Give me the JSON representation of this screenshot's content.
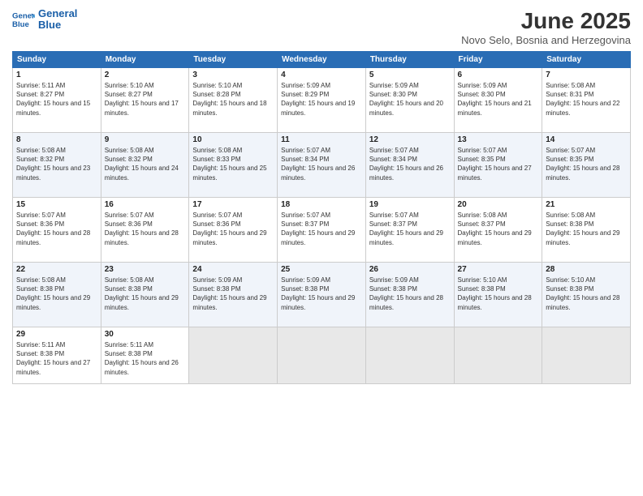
{
  "header": {
    "logo_line1": "General",
    "logo_line2": "Blue",
    "month": "June 2025",
    "location": "Novo Selo, Bosnia and Herzegovina"
  },
  "weekdays": [
    "Sunday",
    "Monday",
    "Tuesday",
    "Wednesday",
    "Thursday",
    "Friday",
    "Saturday"
  ],
  "weeks": [
    [
      {
        "day": "1",
        "sunrise": "Sunrise: 5:11 AM",
        "sunset": "Sunset: 8:27 PM",
        "daylight": "Daylight: 15 hours and 15 minutes."
      },
      {
        "day": "2",
        "sunrise": "Sunrise: 5:10 AM",
        "sunset": "Sunset: 8:27 PM",
        "daylight": "Daylight: 15 hours and 17 minutes."
      },
      {
        "day": "3",
        "sunrise": "Sunrise: 5:10 AM",
        "sunset": "Sunset: 8:28 PM",
        "daylight": "Daylight: 15 hours and 18 minutes."
      },
      {
        "day": "4",
        "sunrise": "Sunrise: 5:09 AM",
        "sunset": "Sunset: 8:29 PM",
        "daylight": "Daylight: 15 hours and 19 minutes."
      },
      {
        "day": "5",
        "sunrise": "Sunrise: 5:09 AM",
        "sunset": "Sunset: 8:30 PM",
        "daylight": "Daylight: 15 hours and 20 minutes."
      },
      {
        "day": "6",
        "sunrise": "Sunrise: 5:09 AM",
        "sunset": "Sunset: 8:30 PM",
        "daylight": "Daylight: 15 hours and 21 minutes."
      },
      {
        "day": "7",
        "sunrise": "Sunrise: 5:08 AM",
        "sunset": "Sunset: 8:31 PM",
        "daylight": "Daylight: 15 hours and 22 minutes."
      }
    ],
    [
      {
        "day": "8",
        "sunrise": "Sunrise: 5:08 AM",
        "sunset": "Sunset: 8:32 PM",
        "daylight": "Daylight: 15 hours and 23 minutes."
      },
      {
        "day": "9",
        "sunrise": "Sunrise: 5:08 AM",
        "sunset": "Sunset: 8:32 PM",
        "daylight": "Daylight: 15 hours and 24 minutes."
      },
      {
        "day": "10",
        "sunrise": "Sunrise: 5:08 AM",
        "sunset": "Sunset: 8:33 PM",
        "daylight": "Daylight: 15 hours and 25 minutes."
      },
      {
        "day": "11",
        "sunrise": "Sunrise: 5:07 AM",
        "sunset": "Sunset: 8:34 PM",
        "daylight": "Daylight: 15 hours and 26 minutes."
      },
      {
        "day": "12",
        "sunrise": "Sunrise: 5:07 AM",
        "sunset": "Sunset: 8:34 PM",
        "daylight": "Daylight: 15 hours and 26 minutes."
      },
      {
        "day": "13",
        "sunrise": "Sunrise: 5:07 AM",
        "sunset": "Sunset: 8:35 PM",
        "daylight": "Daylight: 15 hours and 27 minutes."
      },
      {
        "day": "14",
        "sunrise": "Sunrise: 5:07 AM",
        "sunset": "Sunset: 8:35 PM",
        "daylight": "Daylight: 15 hours and 28 minutes."
      }
    ],
    [
      {
        "day": "15",
        "sunrise": "Sunrise: 5:07 AM",
        "sunset": "Sunset: 8:36 PM",
        "daylight": "Daylight: 15 hours and 28 minutes."
      },
      {
        "day": "16",
        "sunrise": "Sunrise: 5:07 AM",
        "sunset": "Sunset: 8:36 PM",
        "daylight": "Daylight: 15 hours and 28 minutes."
      },
      {
        "day": "17",
        "sunrise": "Sunrise: 5:07 AM",
        "sunset": "Sunset: 8:36 PM",
        "daylight": "Daylight: 15 hours and 29 minutes."
      },
      {
        "day": "18",
        "sunrise": "Sunrise: 5:07 AM",
        "sunset": "Sunset: 8:37 PM",
        "daylight": "Daylight: 15 hours and 29 minutes."
      },
      {
        "day": "19",
        "sunrise": "Sunrise: 5:07 AM",
        "sunset": "Sunset: 8:37 PM",
        "daylight": "Daylight: 15 hours and 29 minutes."
      },
      {
        "day": "20",
        "sunrise": "Sunrise: 5:08 AM",
        "sunset": "Sunset: 8:37 PM",
        "daylight": "Daylight: 15 hours and 29 minutes."
      },
      {
        "day": "21",
        "sunrise": "Sunrise: 5:08 AM",
        "sunset": "Sunset: 8:38 PM",
        "daylight": "Daylight: 15 hours and 29 minutes."
      }
    ],
    [
      {
        "day": "22",
        "sunrise": "Sunrise: 5:08 AM",
        "sunset": "Sunset: 8:38 PM",
        "daylight": "Daylight: 15 hours and 29 minutes."
      },
      {
        "day": "23",
        "sunrise": "Sunrise: 5:08 AM",
        "sunset": "Sunset: 8:38 PM",
        "daylight": "Daylight: 15 hours and 29 minutes."
      },
      {
        "day": "24",
        "sunrise": "Sunrise: 5:09 AM",
        "sunset": "Sunset: 8:38 PM",
        "daylight": "Daylight: 15 hours and 29 minutes."
      },
      {
        "day": "25",
        "sunrise": "Sunrise: 5:09 AM",
        "sunset": "Sunset: 8:38 PM",
        "daylight": "Daylight: 15 hours and 29 minutes."
      },
      {
        "day": "26",
        "sunrise": "Sunrise: 5:09 AM",
        "sunset": "Sunset: 8:38 PM",
        "daylight": "Daylight: 15 hours and 28 minutes."
      },
      {
        "day": "27",
        "sunrise": "Sunrise: 5:10 AM",
        "sunset": "Sunset: 8:38 PM",
        "daylight": "Daylight: 15 hours and 28 minutes."
      },
      {
        "day": "28",
        "sunrise": "Sunrise: 5:10 AM",
        "sunset": "Sunset: 8:38 PM",
        "daylight": "Daylight: 15 hours and 28 minutes."
      }
    ],
    [
      {
        "day": "29",
        "sunrise": "Sunrise: 5:11 AM",
        "sunset": "Sunset: 8:38 PM",
        "daylight": "Daylight: 15 hours and 27 minutes."
      },
      {
        "day": "30",
        "sunrise": "Sunrise: 5:11 AM",
        "sunset": "Sunset: 8:38 PM",
        "daylight": "Daylight: 15 hours and 26 minutes."
      },
      {
        "day": "",
        "sunrise": "",
        "sunset": "",
        "daylight": ""
      },
      {
        "day": "",
        "sunrise": "",
        "sunset": "",
        "daylight": ""
      },
      {
        "day": "",
        "sunrise": "",
        "sunset": "",
        "daylight": ""
      },
      {
        "day": "",
        "sunrise": "",
        "sunset": "",
        "daylight": ""
      },
      {
        "day": "",
        "sunrise": "",
        "sunset": "",
        "daylight": ""
      }
    ]
  ]
}
